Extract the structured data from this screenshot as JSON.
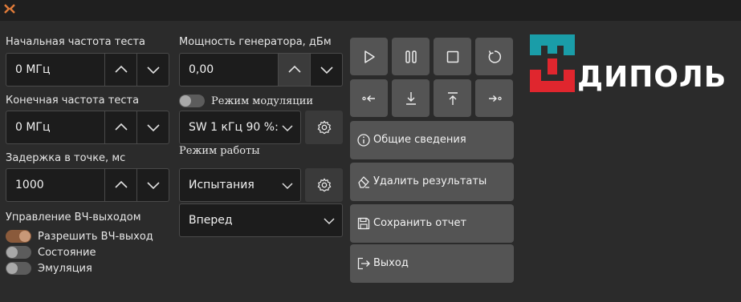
{
  "window": {
    "icon": "app-logo-icon"
  },
  "frequency": {
    "start_label": "Начальная частота теста",
    "start_value": "0 МГц",
    "end_label": "Конечная частота теста",
    "end_value": "0 МГц",
    "delay_label": "Задержка в точке, мс",
    "delay_value": "1000"
  },
  "rf_output": {
    "section_label": "Управление ВЧ-выходом",
    "enable_label": "Разрешить ВЧ-выход",
    "enable_on": true,
    "state_label": "Состояние",
    "state_on": false,
    "emulation_label": "Эмуляция",
    "emulation_on": false
  },
  "generator": {
    "power_label": "Мощность генератора, дБм",
    "power_value": "0,00",
    "modulation_label": "Режим модуляции",
    "modulation_on": false,
    "modulation_value": "SW 1 кГц 90 %:",
    "mode_label": "Режим работы",
    "mode_value": "Испытания",
    "direction_value": "Вперед"
  },
  "toolbar": {
    "icons": [
      "play-icon",
      "pause-icon",
      "stop-icon",
      "refresh-icon",
      "arrow-left-icon",
      "download-icon",
      "upload-icon",
      "arrow-right-icon"
    ]
  },
  "actions": {
    "info_label": "Общие сведения",
    "delete_label": "Удалить результаты",
    "save_label": "Сохранить отчет",
    "exit_label": "Выход"
  },
  "brand": {
    "logo_text": "ДИПОЛЬ",
    "teal": "#1a9da8",
    "red": "#e0262e"
  }
}
